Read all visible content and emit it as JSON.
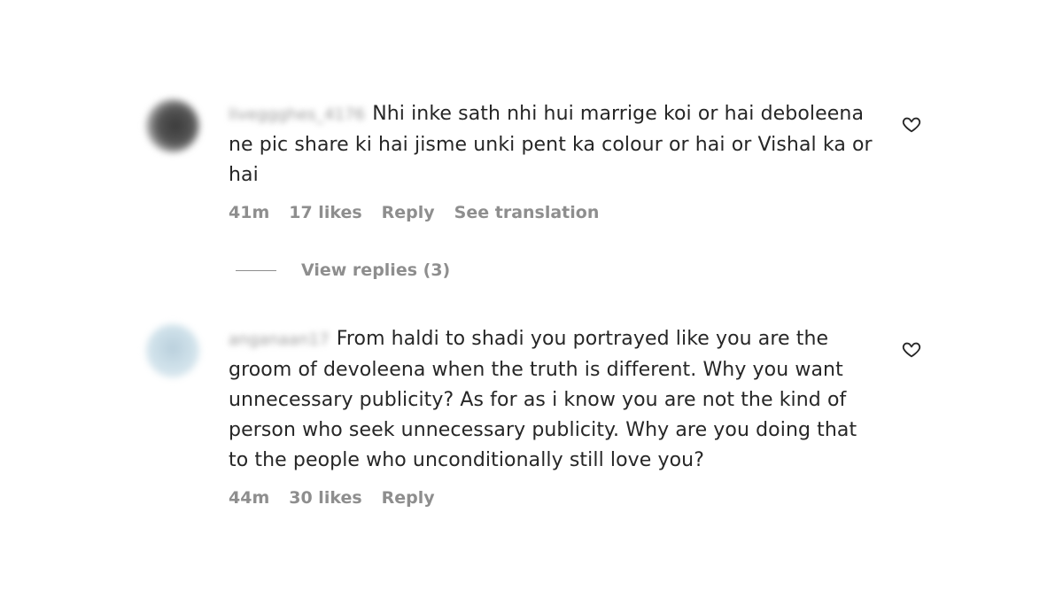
{
  "comments": [
    {
      "username": "liveggghes_4176",
      "text": "Nhi inke sath nhi hui marrige koi or hai deboleena ne pic share ki hai jisme unki pent ka colour or hai or Vishal ka or hai",
      "time": "41m",
      "likes": "17 likes",
      "reply_label": "Reply",
      "translation_label": "See translation",
      "like_icon": "heart-outline-icon"
    },
    {
      "username": "anganaan17",
      "text": "From haldi to shadi you portrayed like you are the groom of devoleena when the truth is different. Why you want unnecessary publicity? As for as i know you are not the kind of person who seek unnecessary publicity. Why are you doing that to the people who unconditionally still love you?",
      "time": "44m",
      "likes": "30 likes",
      "reply_label": "Reply",
      "like_icon": "heart-outline-icon"
    }
  ],
  "view_replies_label": "View replies (3)"
}
